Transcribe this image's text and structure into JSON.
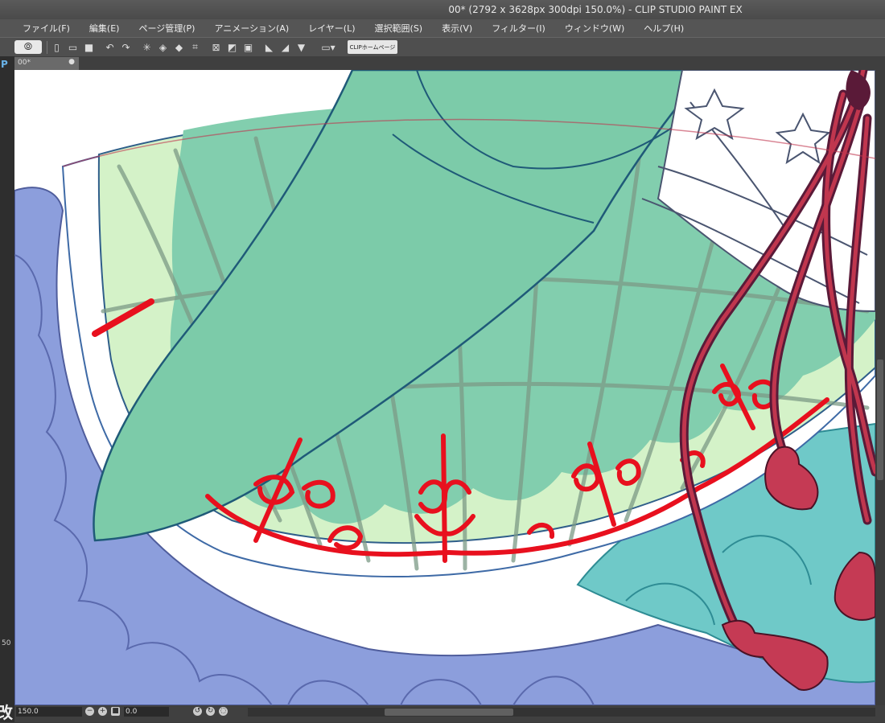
{
  "window": {
    "title": "00* (2792 x 3628px 300dpi 150.0%) - CLIP STUDIO PAINT EX"
  },
  "menu": [
    "ファイル(F)",
    "編集(E)",
    "ページ管理(P)",
    "アニメーション(A)",
    "レイヤー(L)",
    "選択範囲(S)",
    "表示(V)",
    "フィルター(I)",
    "ウィンドウ(W)",
    "ヘルプ(H)"
  ],
  "toolbar": {
    "logo_icon": "clip-studio-logo-icon",
    "home_label": "CLIPホームページ"
  },
  "tab": {
    "label": "00*",
    "close": "●"
  },
  "left_strip": {
    "top_char": "P",
    "mid_text": "50",
    "bottom_char": "改"
  },
  "status": {
    "zoom": "150.0",
    "rotation": "0.0"
  },
  "colors": {
    "accent_blue": "#6ab3e8",
    "skirt_green": "#7fceaa",
    "lace_green": "#d4f2c8",
    "ornament_red": "#e8101e",
    "ruffle_blue": "#8c9edc",
    "cord_crimson": "#c0364e"
  }
}
